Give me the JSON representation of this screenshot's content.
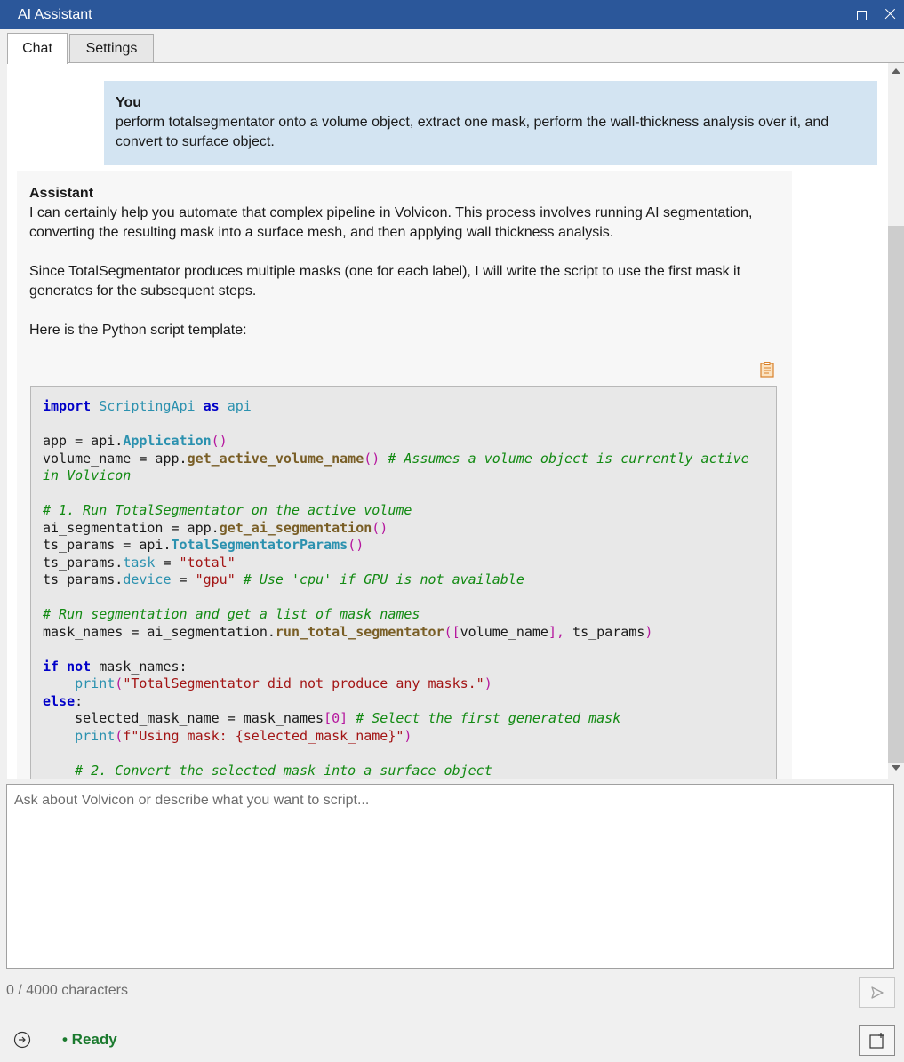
{
  "window": {
    "title": "AI Assistant"
  },
  "tabs": [
    {
      "label": "Chat"
    },
    {
      "label": "Settings"
    }
  ],
  "messages": {
    "user": {
      "author": "You",
      "text": "perform totalsegmentator onto a volume object, extract one mask, perform the wall-thickness analysis over it, and convert to surface object."
    },
    "assistant": {
      "author": "Assistant",
      "paragraphs": [
        "I can certainly help you automate that complex pipeline in Volvicon. This process involves running AI segmentation, converting the resulting mask into a surface mesh, and then applying wall thickness analysis.",
        "Since TotalSegmentator produces multiple masks (one for each label), I will write the script to use the first mask it generates for the subsequent steps.",
        "Here is the Python script template:"
      ]
    }
  },
  "code": {
    "l01_kw": "import",
    "l01_mod": "ScriptingApi",
    "l01_as": "as",
    "l01_alias": "api",
    "l03_a": "app = api.",
    "l03_cls": "Application",
    "l03_p": "()",
    "l04_a": "volume_name = app.",
    "l04_fn": "get_active_volume_name",
    "l04_p": "()",
    "l04_cm": "# Assumes a volume object is currently active",
    "l05_cm": "in Volvicon",
    "l07_cm": "# 1. Run TotalSegmentator on the active volume",
    "l08_a": "ai_segmentation = app.",
    "l08_fn": "get_ai_segmentation",
    "l08_p": "()",
    "l09_a": "ts_params = api.",
    "l09_cls": "TotalSegmentatorParams",
    "l09_p": "()",
    "l10_a": "ts_params.",
    "l10_attr": "task",
    "l10_eq": " = ",
    "l10_str": "\"total\"",
    "l11_a": "ts_params.",
    "l11_attr": "device",
    "l11_eq": " = ",
    "l11_str": "\"gpu\"",
    "l11_cm": "# Use 'cpu' if GPU is not available",
    "l13_cm": "# Run segmentation and get a list of mask names",
    "l14_a": "mask_names = ai_segmentation.",
    "l14_fn": "run_total_segmentator",
    "l14_p1": "([",
    "l14_b": "volume_name",
    "l14_p2": "],",
    "l14_c": " ts_params",
    "l14_p3": ")",
    "l16_kw1": "if",
    "l16_kw2": "not",
    "l16_a": " mask_names:",
    "l17_bi": "print",
    "l17_p1": "(",
    "l17_str": "\"TotalSegmentator did not produce any masks.\"",
    "l17_p2": ")",
    "l18_kw": "else",
    "l18_a": ":",
    "l19_a": "selected_mask_name = mask_names",
    "l19_p": "[0]",
    "l19_cm": "# Select the first generated mask",
    "l20_bi": "print",
    "l20_p1": "(",
    "l20_str": "f\"Using mask: {selected_mask_name}\"",
    "l20_p2": ")",
    "l22_cm": "# 2. Convert the selected mask into a surface object"
  },
  "input": {
    "placeholder": "Ask about Volvicon or describe what you want to script..."
  },
  "footer": {
    "char_count": "0 / 4000 characters",
    "status": "• Ready"
  },
  "icons": {
    "copy": "clipboard-icon",
    "send": "send-arrow-icon",
    "options": "circle-arrow-icon",
    "new_chat": "new-chat-icon",
    "maximize": "maximize-icon",
    "close": "close-icon"
  },
  "colors": {
    "titlebar": "#2b579a",
    "user_bubble": "#d3e4f2",
    "status_ready": "#1b7a2e"
  }
}
